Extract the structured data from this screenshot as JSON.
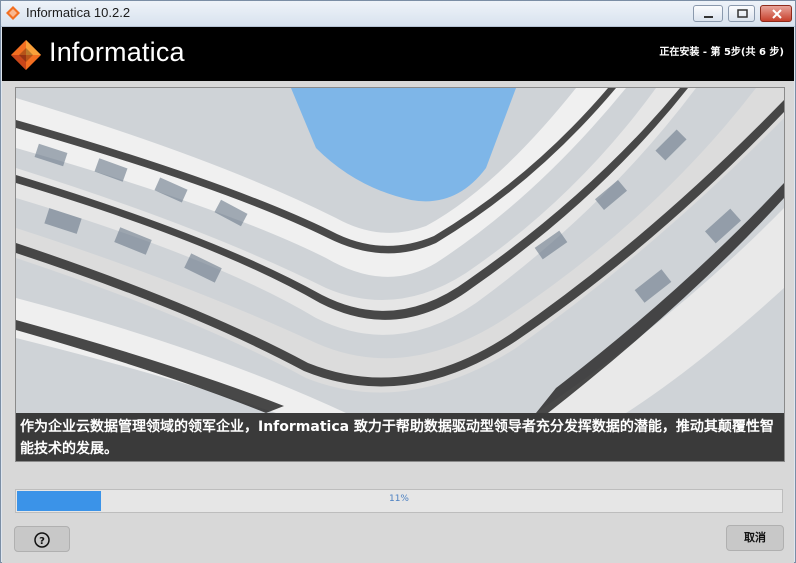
{
  "window": {
    "title": "Informatica 10.2.2"
  },
  "header": {
    "logo_text": "Informatica",
    "step_status": "正在安装 - 第 5步(共 6 步)"
  },
  "main": {
    "caption": "作为企业云数据管理领域的领军企业，Informatica 致力于帮助数据驱动型领导者充分发挥数据的潜能，推动其颠覆性智能技术的发展。"
  },
  "progress": {
    "percent_label": "11%",
    "fraction": 0.11
  },
  "footer": {
    "help_icon": "question-circle-icon",
    "cancel_label": "取消"
  },
  "colors": {
    "progress": "#3b93e8",
    "header_bg": "#000000",
    "brand_orange": "#f36f21"
  }
}
